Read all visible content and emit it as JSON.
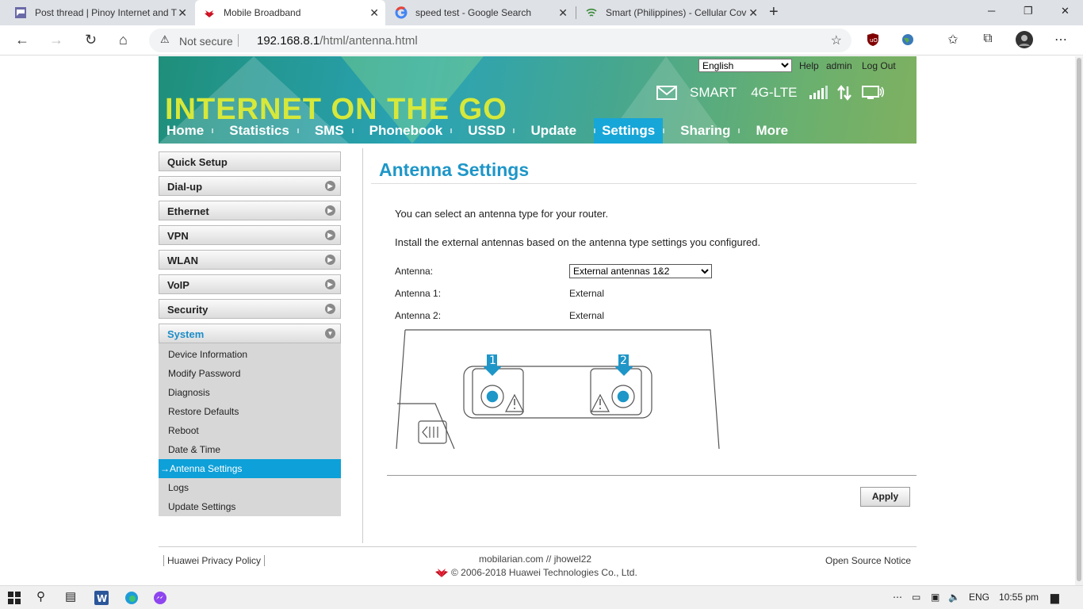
{
  "browser": {
    "tabs": [
      {
        "title": "Post thread | Pinoy Internet and T",
        "active": false
      },
      {
        "title": "Mobile Broadband",
        "active": true
      },
      {
        "title": "speed test - Google Search",
        "active": false
      },
      {
        "title": "Smart (Philippines) - Cellular Cov",
        "active": false
      }
    ],
    "address": {
      "security": "Not secure",
      "host": "192.168.8.1",
      "path": "/html/antenna.html"
    }
  },
  "header": {
    "slogan": "INTERNET ON THE GO",
    "language": "English",
    "help": "Help",
    "user": "admin",
    "logout": "Log Out",
    "operator": "SMART",
    "network": "4G-LTE"
  },
  "nav": [
    "Home",
    "Statistics",
    "SMS",
    "Phonebook",
    "USSD",
    "Update",
    "Settings",
    "Sharing",
    "More"
  ],
  "nav_selected": "Settings",
  "sidebar": {
    "sections": [
      "Quick Setup",
      "Dial-up",
      "Ethernet",
      "VPN",
      "WLAN",
      "VoIP",
      "Security",
      "System"
    ],
    "open_section": "System",
    "items": [
      "Device Information",
      "Modify Password",
      "Diagnosis",
      "Restore Defaults",
      "Reboot",
      "Date & Time",
      "Antenna Settings",
      "Logs",
      "Update Settings"
    ],
    "current_item": "Antenna Settings"
  },
  "content": {
    "title": "Antenna Settings",
    "intro1": "You can select an antenna type for your router.",
    "intro2": "Install the external antennas based on the antenna type settings you configured.",
    "antenna_label": "Antenna:",
    "antenna_value": "External antennas 1&2",
    "ant1_label": "Antenna 1:",
    "ant1_value": "External",
    "ant2_label": "Antenna 2:",
    "ant2_value": "External",
    "diagram_port1": "1",
    "diagram_port2": "2",
    "apply": "Apply"
  },
  "footer": {
    "privacy": "Huawei Privacy Policy",
    "credit": "mobilarian.com // jhowel22",
    "copyright": "© 2006-2018 Huawei Technologies Co., Ltd.",
    "opensource": "Open Source Notice"
  },
  "taskbar": {
    "language": "ENG",
    "time": "10:55 pm"
  },
  "colors": {
    "accent": "#1e96c8",
    "selected_item": "#0ea0d8",
    "slogan": "#d7e83a"
  }
}
